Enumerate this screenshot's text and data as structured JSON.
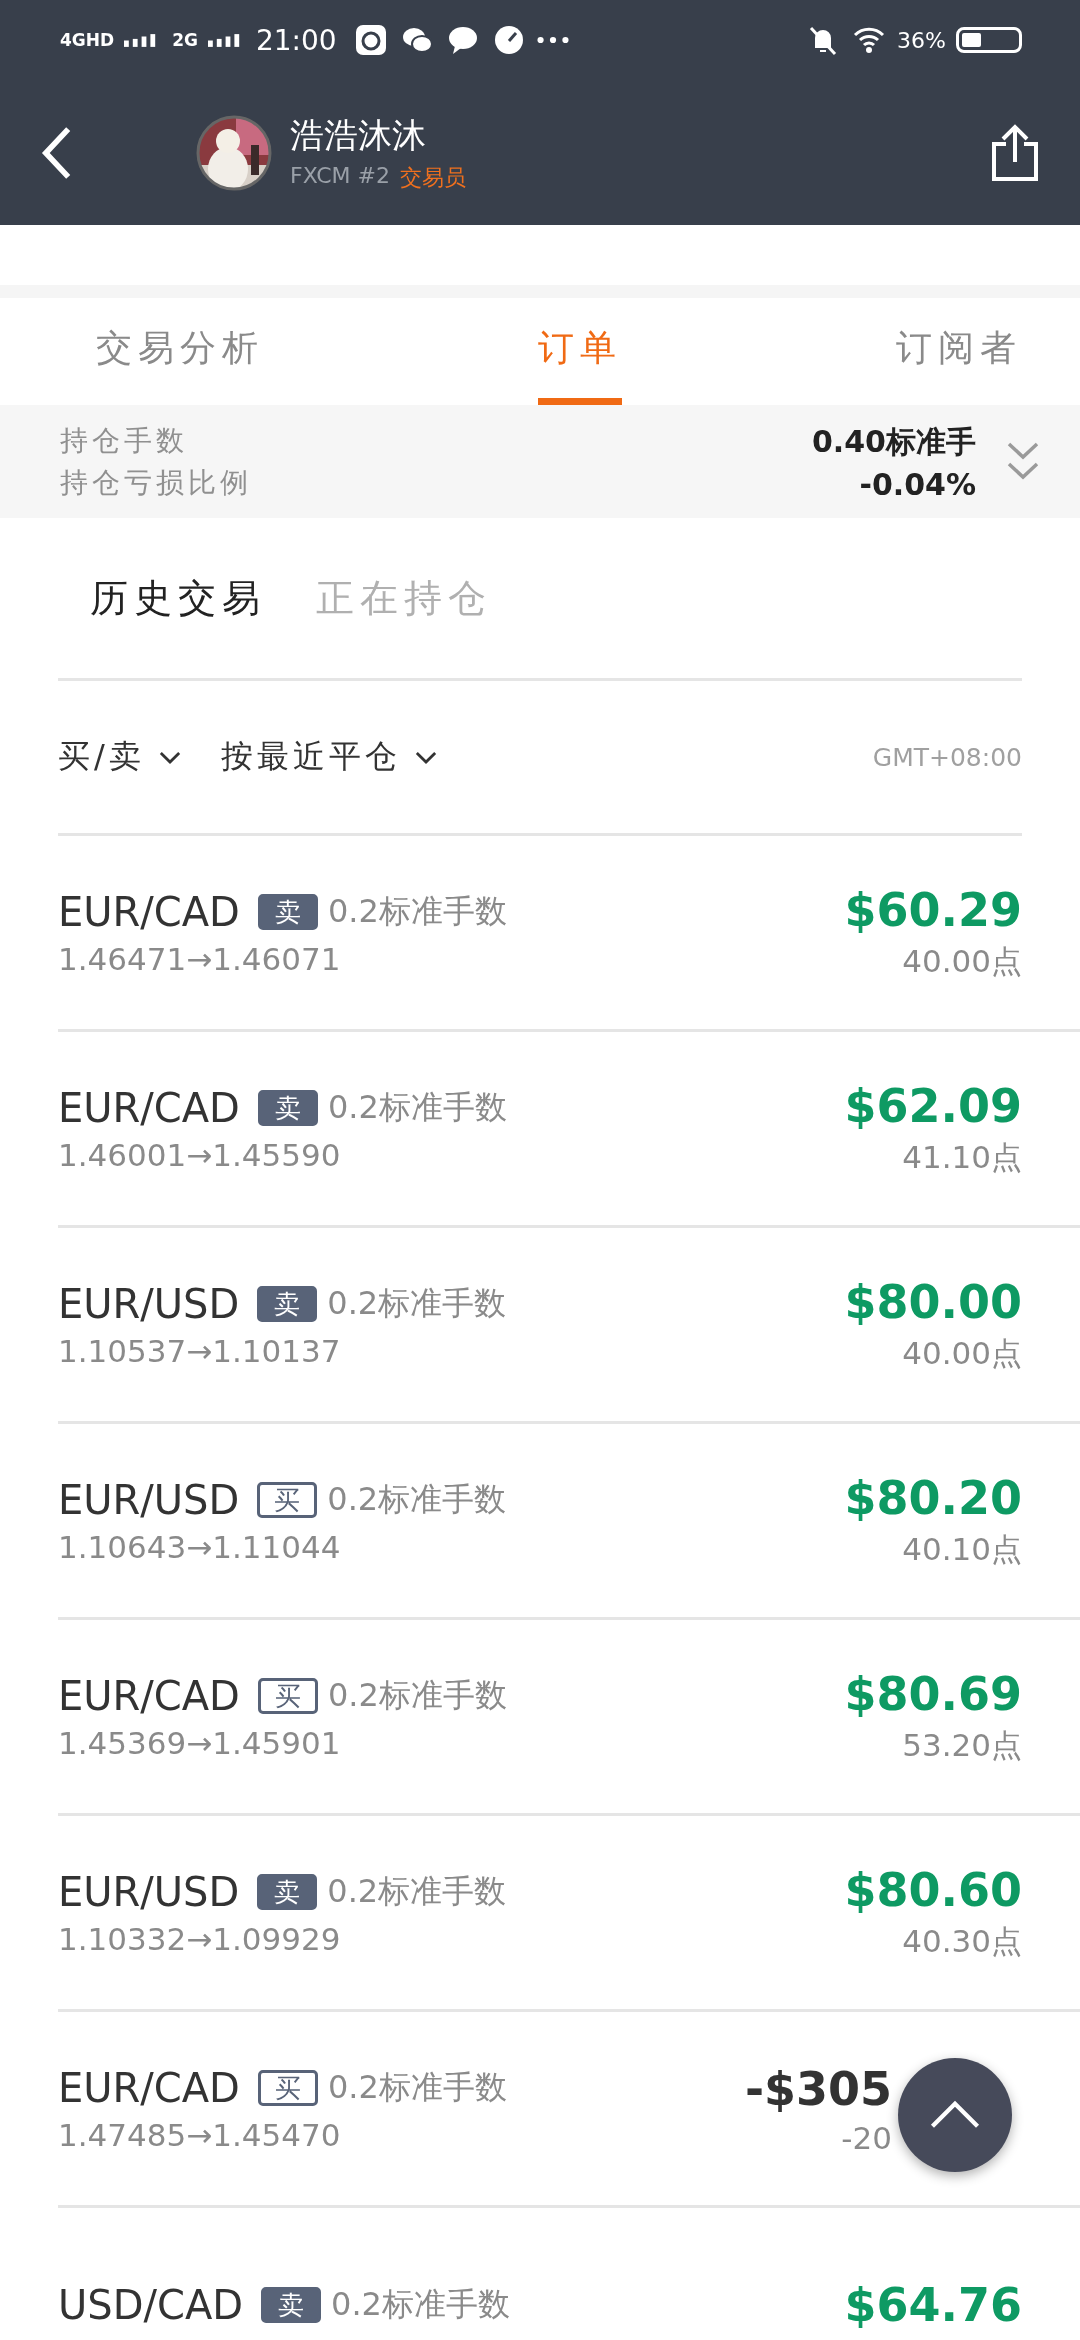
{
  "status_bar": {
    "network_1": "4GHD",
    "network_2": "2G",
    "time": "21:00",
    "battery": "36%"
  },
  "header": {
    "title": "浩浩沐沐",
    "broker": "FXCM #2",
    "role": "交易员"
  },
  "tabs": [
    {
      "label": "交易分析",
      "selected": false
    },
    {
      "label": "订单",
      "selected": true
    },
    {
      "label": "订阅者",
      "selected": false
    }
  ],
  "summary": {
    "labels": [
      "持仓手数",
      "持仓亏损比例"
    ],
    "values": [
      "0.40标准手",
      "-0.04%"
    ]
  },
  "sub_tabs": [
    {
      "label": "历史交易",
      "selected": true
    },
    {
      "label": "正在持仓",
      "selected": false
    }
  ],
  "filters": [
    "买/卖",
    "按最近平仓"
  ],
  "timezone": "GMT+08:00",
  "trades": [
    {
      "symbol": "EUR/CAD",
      "kind": "sell",
      "side": "卖",
      "lots": "0.2标准手数",
      "prices": "1.46471→1.46071",
      "profit": "$60.29",
      "color": "#0e9a63",
      "points": "40.00点"
    },
    {
      "symbol": "EUR/CAD",
      "kind": "sell",
      "side": "卖",
      "lots": "0.2标准手数",
      "prices": "1.46001→1.45590",
      "profit": "$62.09",
      "color": "#0e9a63",
      "points": "41.10点"
    },
    {
      "symbol": "EUR/USD",
      "kind": "sell",
      "side": "卖",
      "lots": "0.2标准手数",
      "prices": "1.10537→1.10137",
      "profit": "$80.00",
      "color": "#0e9a63",
      "points": "40.00点"
    },
    {
      "symbol": "EUR/USD",
      "kind": "buy",
      "side": "买",
      "lots": "0.2标准手数",
      "prices": "1.10643→1.11044",
      "profit": "$80.20",
      "color": "#0e9a63",
      "points": "40.10点"
    },
    {
      "symbol": "EUR/CAD",
      "kind": "buy",
      "side": "买",
      "lots": "0.2标准手数",
      "prices": "1.45369→1.45901",
      "profit": "$80.69",
      "color": "#0e9a63",
      "points": "53.20点"
    },
    {
      "symbol": "EUR/USD",
      "kind": "sell",
      "side": "卖",
      "lots": "0.2标准手数",
      "prices": "1.10332→1.09929",
      "profit": "$80.60",
      "color": "#0e9a63",
      "points": "40.30点"
    },
    {
      "symbol": "EUR/CAD",
      "kind": "buy",
      "side": "买",
      "lots": "0.2标准手数",
      "prices": "1.47485→1.45470",
      "profit": "-$305",
      "color": "#333333",
      "points": "-20",
      "covered": true
    },
    {
      "symbol": "USD/CAD",
      "kind": "sell",
      "side": "卖",
      "lots": "0.2标准手数",
      "profit": "$64.76",
      "color": "#0e9a63"
    }
  ]
}
